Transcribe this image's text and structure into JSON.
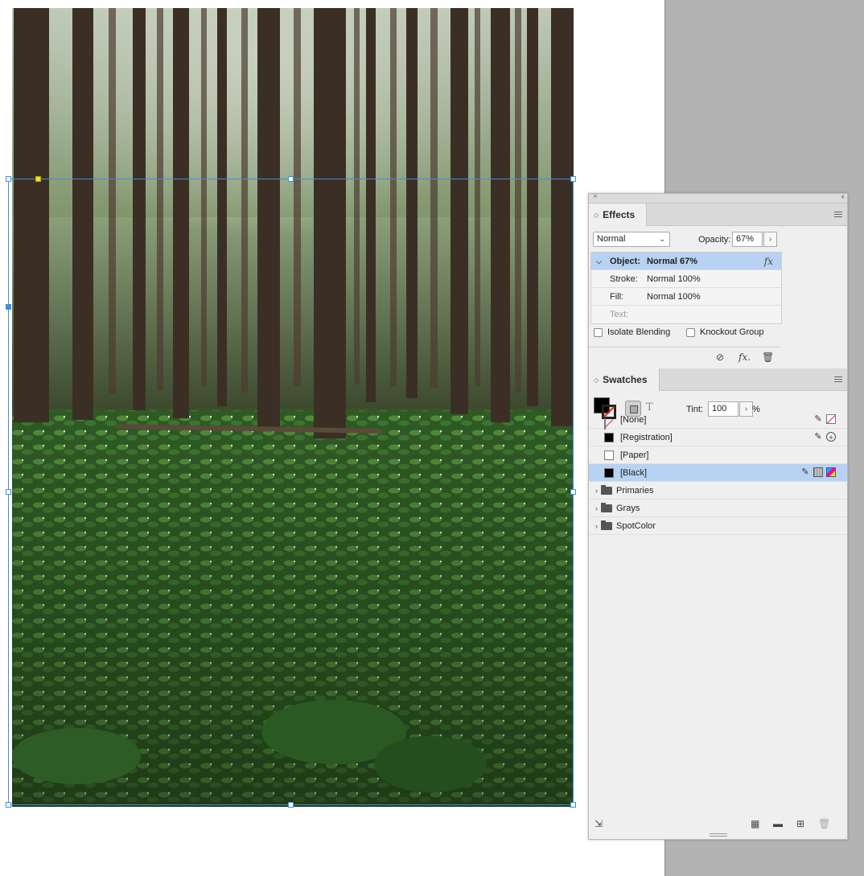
{
  "canvas": {
    "photo_description_alt": "",
    "selection_color": "#3f8fd9"
  },
  "panel": {
    "titlebar": {
      "close_icon": "×",
      "collapse_icon": "‹‹"
    },
    "effects": {
      "tab_label": "Effects",
      "blend_mode": "Normal",
      "opacity_label": "Opacity:",
      "opacity_value": "67%",
      "rows": [
        {
          "label": "Object:",
          "value": "Normal 67%",
          "selected": true
        },
        {
          "label": "Stroke:",
          "value": "Normal 100%"
        },
        {
          "label": "Fill:",
          "value": "Normal 100%"
        },
        {
          "label": "Text:",
          "value": ""
        }
      ],
      "isolate_blending_label": "Isolate Blending",
      "knockout_group_label": "Knockout Group",
      "fx_icon": "fx"
    },
    "swatches": {
      "tab_label": "Swatches",
      "tint_label": "Tint:",
      "tint_value": "100",
      "tint_unit": "%",
      "text_icon": "T",
      "items": [
        {
          "name": "[None]",
          "chip": "none"
        },
        {
          "name": "[Registration]",
          "chip": "#000000"
        },
        {
          "name": "[Paper]",
          "chip": "#ffffff"
        },
        {
          "name": "[Black]",
          "chip": "#000000",
          "selected": true
        }
      ],
      "groups": [
        "Primaries",
        "Grays",
        "SpotColor"
      ]
    }
  }
}
